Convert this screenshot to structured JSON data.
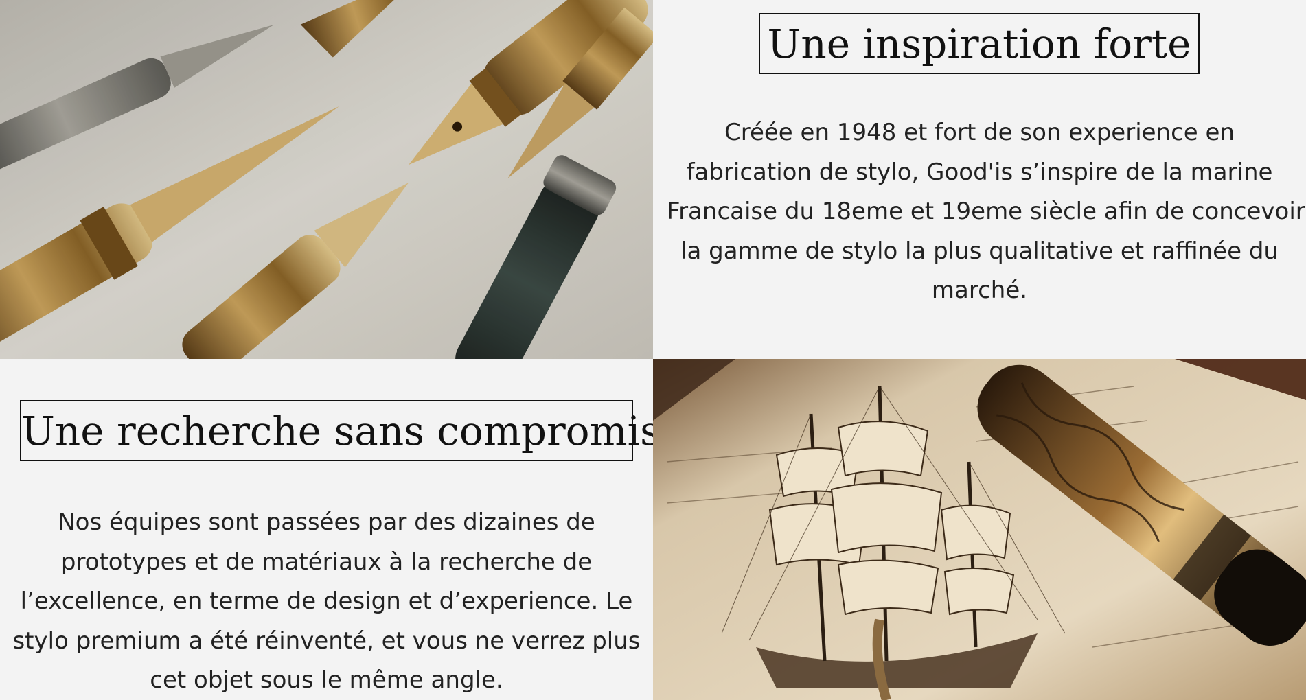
{
  "section_inspiration": {
    "title": "Une inspiration forte",
    "paragraph_lines": [
      "Créée en 1948 et fort de son experience en",
      "fabrication de stylo, Good'is s’inspire de la marine",
      "Francaise du 18eme et 19eme siècle afin de concevoir",
      "la gamme de stylo la plus qualitative et raffinée du",
      "marché."
    ]
  },
  "section_recherche": {
    "title": "Une recherche sans compromis",
    "paragraph_lines": [
      "Nos équipes sont passées par des dizaines de",
      "prototypes et de matériaux à la recherche de",
      "l’excellence, en terme de design et d’experience. Le",
      "stylo premium a été réinventé, et vous ne verrez plus",
      "cet objet sous le même angle."
    ]
  },
  "images": {
    "top_left": "fountain-pen-nibs-photo",
    "bottom_right": "pen-and-sailing-ship-engraving-photo"
  },
  "colors": {
    "background": "#f3f3f3",
    "text": "#222222",
    "title_border": "#111111",
    "gold": "#b08a4a",
    "sepia": "#cfbfa5"
  }
}
